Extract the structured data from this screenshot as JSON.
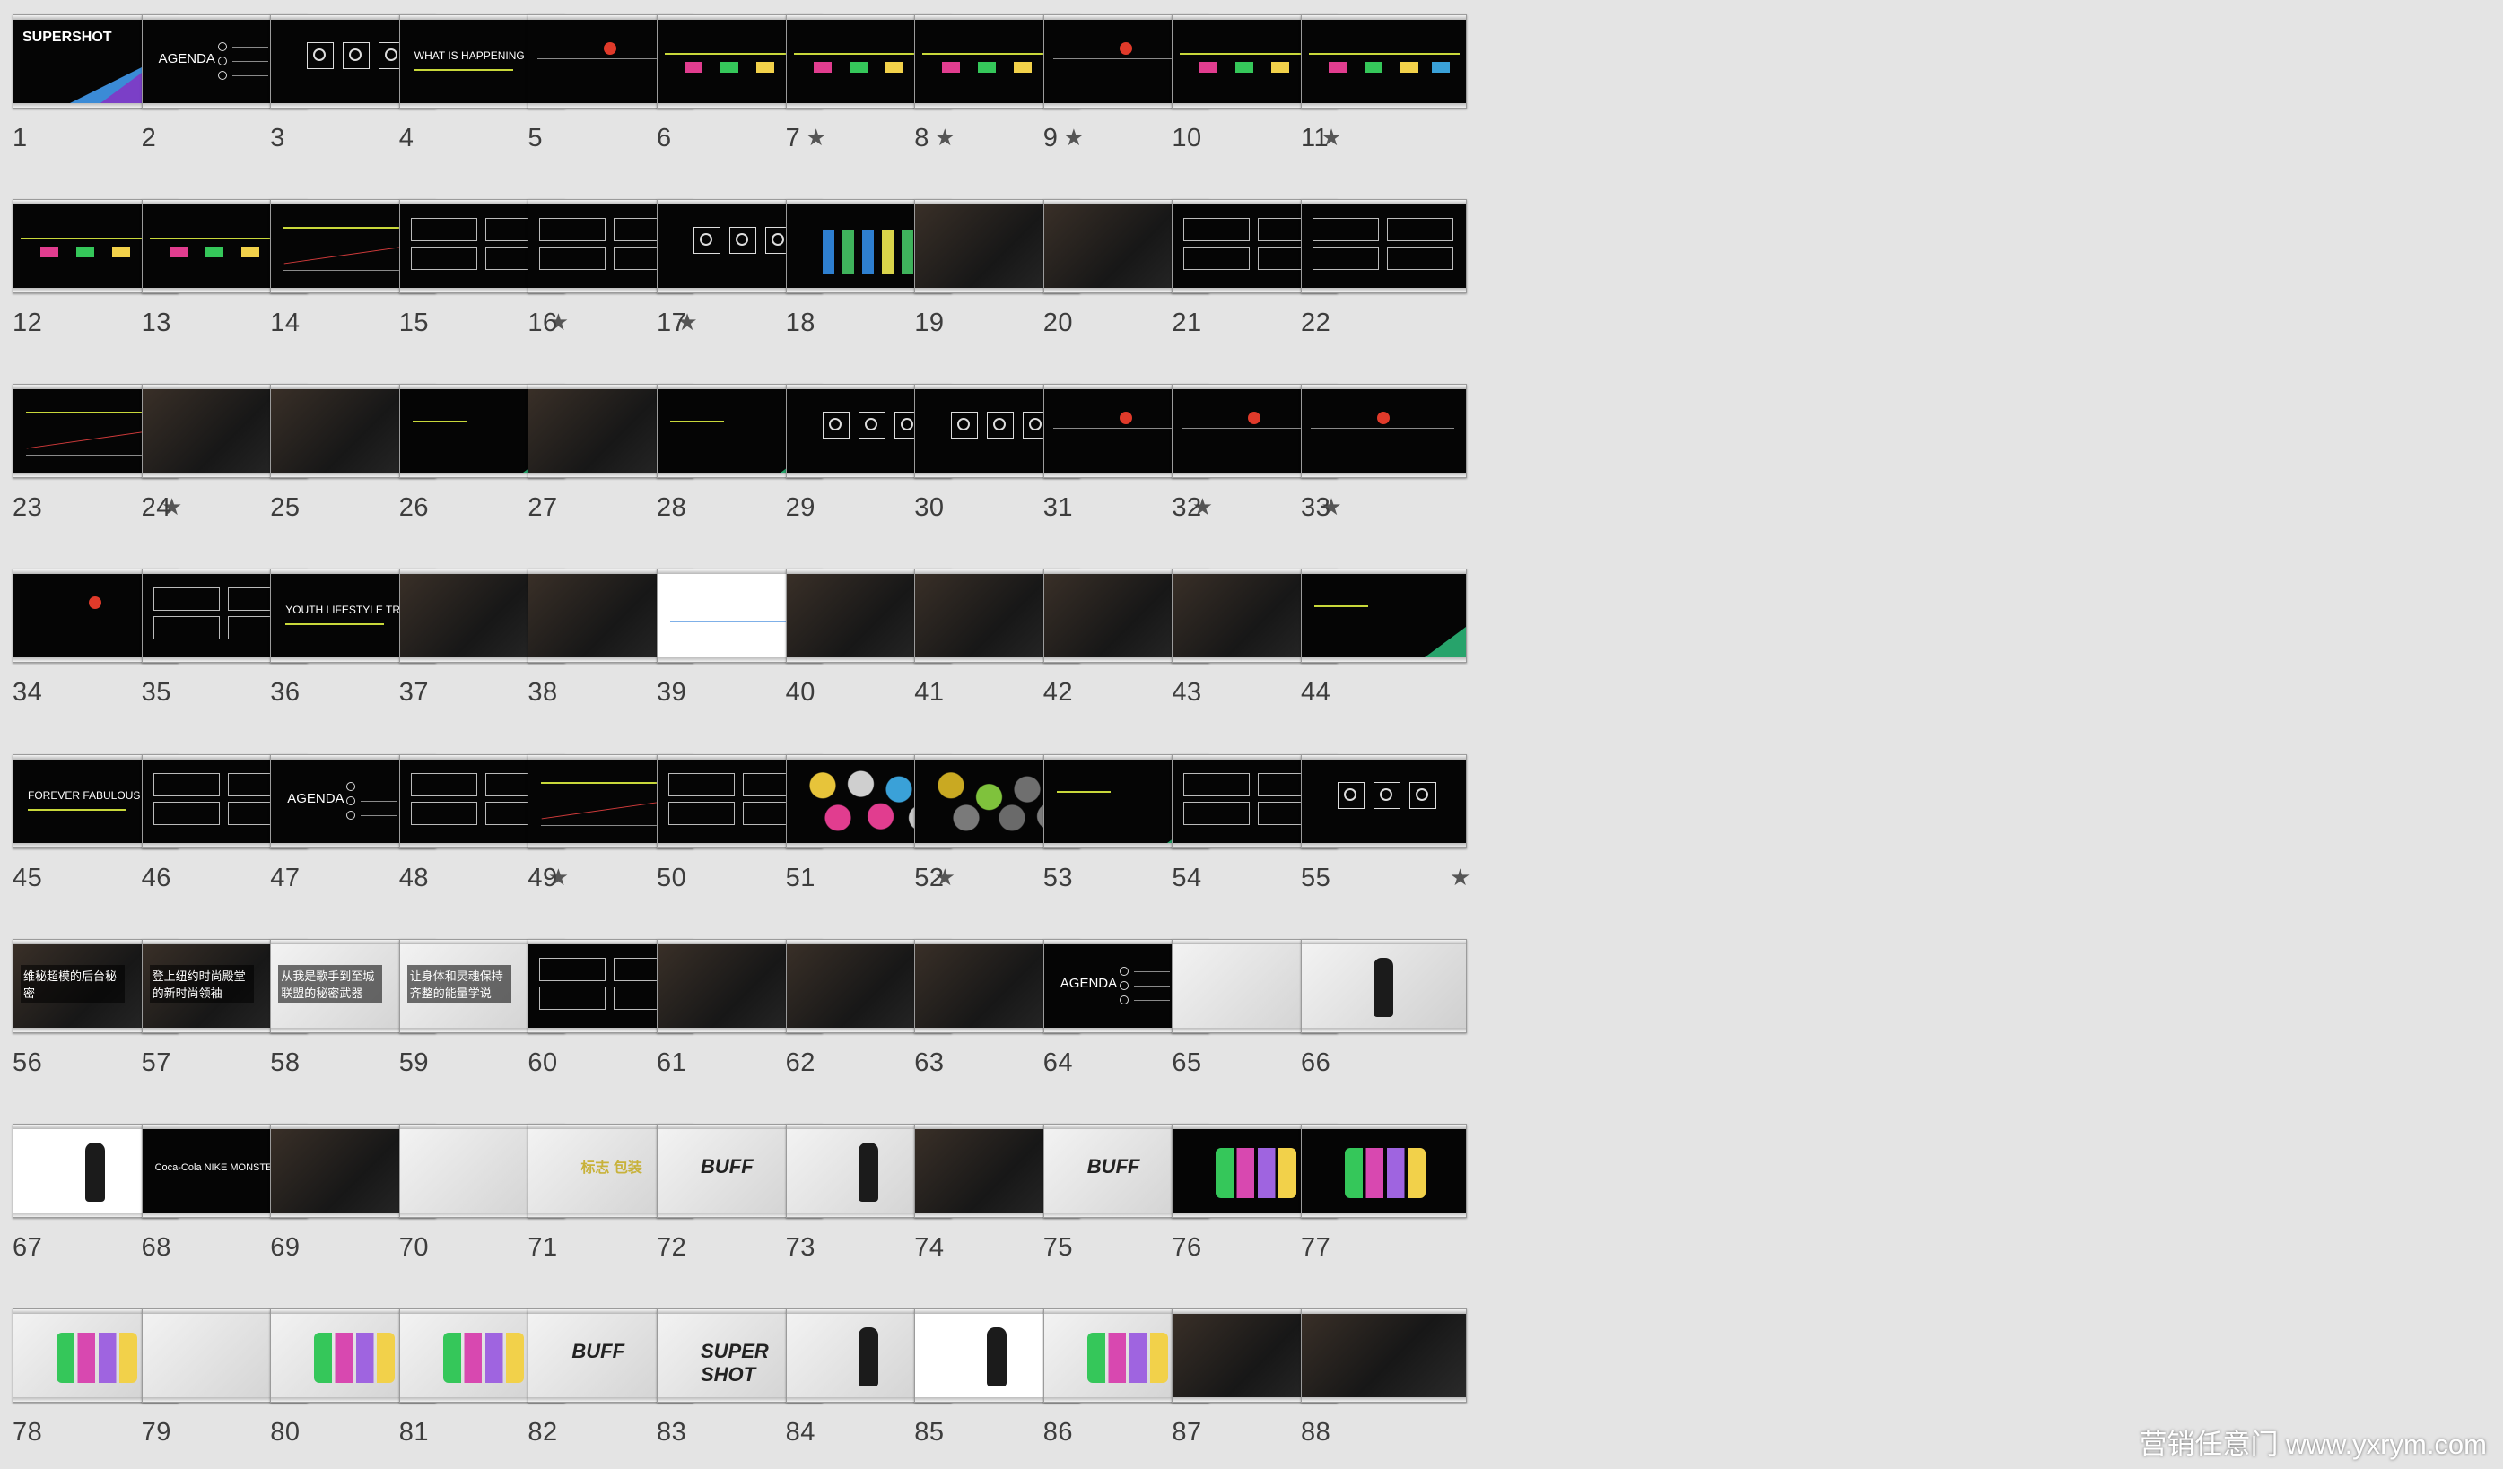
{
  "app": {
    "view": "slide-sorter"
  },
  "slides": [
    {
      "n": "1",
      "star": false,
      "style": "cover",
      "title": "SUPERSHOT"
    },
    {
      "n": "2",
      "star": false,
      "style": "agenda",
      "title": "AGENDA"
    },
    {
      "n": "3",
      "star": false,
      "style": "icons"
    },
    {
      "n": "4",
      "star": false,
      "style": "title",
      "title": "WHAT IS HAPPENING"
    },
    {
      "n": "5",
      "star": false,
      "style": "line"
    },
    {
      "n": "6",
      "star": true,
      "style": "timeline"
    },
    {
      "n": "7",
      "star": true,
      "style": "timeline"
    },
    {
      "n": "8",
      "star": true,
      "style": "timeline"
    },
    {
      "n": "9",
      "star": false,
      "style": "line"
    },
    {
      "n": "10",
      "star": true,
      "style": "timeline"
    },
    {
      "n": "11",
      "star": false,
      "style": "timeline"
    },
    {
      "n": "12",
      "star": false,
      "style": "timeline"
    },
    {
      "n": "13",
      "star": false,
      "style": "timeline"
    },
    {
      "n": "14",
      "star": false,
      "style": "chart-line"
    },
    {
      "n": "15",
      "star": true,
      "style": "boxes"
    },
    {
      "n": "16",
      "star": true,
      "style": "boxes"
    },
    {
      "n": "17",
      "star": false,
      "style": "icons"
    },
    {
      "n": "18",
      "star": false,
      "style": "bars"
    },
    {
      "n": "19",
      "star": false,
      "style": "photo"
    },
    {
      "n": "20",
      "star": false,
      "style": "photo"
    },
    {
      "n": "21",
      "star": false,
      "style": "boxes"
    },
    {
      "n": "22",
      "star": false,
      "style": "boxes"
    },
    {
      "n": "23",
      "star": true,
      "style": "chart-line"
    },
    {
      "n": "24",
      "star": false,
      "style": "photo"
    },
    {
      "n": "25",
      "star": false,
      "style": "photo"
    },
    {
      "n": "26",
      "star": false,
      "style": "tri"
    },
    {
      "n": "27",
      "star": false,
      "style": "photo"
    },
    {
      "n": "28",
      "star": false,
      "style": "tri"
    },
    {
      "n": "29",
      "star": false,
      "style": "icons"
    },
    {
      "n": "30",
      "star": false,
      "style": "icons"
    },
    {
      "n": "31",
      "star": true,
      "style": "line"
    },
    {
      "n": "32",
      "star": true,
      "style": "line"
    },
    {
      "n": "33",
      "star": false,
      "style": "line"
    },
    {
      "n": "34",
      "star": false,
      "style": "line"
    },
    {
      "n": "35",
      "star": false,
      "style": "boxes"
    },
    {
      "n": "36",
      "star": false,
      "style": "title",
      "title": "YOUTH LIFESTYLE TREND"
    },
    {
      "n": "37",
      "star": false,
      "style": "photo"
    },
    {
      "n": "38",
      "star": false,
      "style": "photo"
    },
    {
      "n": "39",
      "star": false,
      "style": "white"
    },
    {
      "n": "40",
      "star": false,
      "style": "photo"
    },
    {
      "n": "41",
      "star": false,
      "style": "photo"
    },
    {
      "n": "42",
      "star": false,
      "style": "photo"
    },
    {
      "n": "43",
      "star": false,
      "style": "photo"
    },
    {
      "n": "44",
      "star": false,
      "style": "tri"
    },
    {
      "n": "45",
      "star": false,
      "style": "title",
      "title": "FOREVER FABULOUS"
    },
    {
      "n": "46",
      "star": false,
      "style": "boxes"
    },
    {
      "n": "47",
      "star": false,
      "style": "agenda",
      "title": "AGENDA"
    },
    {
      "n": "48",
      "star": true,
      "style": "boxes"
    },
    {
      "n": "49",
      "star": false,
      "style": "chart-line"
    },
    {
      "n": "50",
      "star": false,
      "style": "boxes"
    },
    {
      "n": "51",
      "star": true,
      "style": "hex"
    },
    {
      "n": "52",
      "star": false,
      "style": "hex-grey"
    },
    {
      "n": "53",
      "star": false,
      "style": "tri"
    },
    {
      "n": "54",
      "star": false,
      "style": "boxes"
    },
    {
      "n": "55",
      "star": true,
      "style": "icons"
    },
    {
      "n": "56",
      "star": false,
      "style": "photo-cn",
      "title": "维秘超模的后台秘密"
    },
    {
      "n": "57",
      "star": false,
      "style": "photo-cn",
      "title": "登上纽约时尚殿堂的新时尚领袖"
    },
    {
      "n": "58",
      "star": false,
      "style": "photo-cn-light",
      "title": "从我是歌手到至城联盟的秘密武器"
    },
    {
      "n": "59",
      "star": false,
      "style": "photo-cn-light",
      "title": "让身体和灵魂保持齐整的能量学说"
    },
    {
      "n": "60",
      "star": false,
      "style": "boxes"
    },
    {
      "n": "61",
      "star": false,
      "style": "photo"
    },
    {
      "n": "62",
      "star": false,
      "style": "photo"
    },
    {
      "n": "63",
      "star": false,
      "style": "photo"
    },
    {
      "n": "64",
      "star": false,
      "style": "agenda",
      "title": "AGENDA"
    },
    {
      "n": "65",
      "star": false,
      "style": "light"
    },
    {
      "n": "66",
      "star": false,
      "style": "bottle"
    },
    {
      "n": "67",
      "star": false,
      "style": "white-bottles"
    },
    {
      "n": "68",
      "star": false,
      "style": "logos",
      "title": "Coca-Cola NIKE MONSTER"
    },
    {
      "n": "69",
      "star": false,
      "style": "photo"
    },
    {
      "n": "70",
      "star": false,
      "style": "light"
    },
    {
      "n": "71",
      "star": false,
      "style": "light-cn",
      "title": "标志 包装"
    },
    {
      "n": "72",
      "star": false,
      "style": "light-logo",
      "title": "BUFF"
    },
    {
      "n": "73",
      "star": false,
      "style": "bottle"
    },
    {
      "n": "74",
      "star": false,
      "style": "photo"
    },
    {
      "n": "75",
      "star": false,
      "style": "light-logo",
      "title": "BUFF"
    },
    {
      "n": "76",
      "star": false,
      "style": "cans"
    },
    {
      "n": "77",
      "star": false,
      "style": "cans"
    },
    {
      "n": "78",
      "star": false,
      "style": "cans-light"
    },
    {
      "n": "79",
      "star": false,
      "style": "light"
    },
    {
      "n": "80",
      "star": false,
      "style": "cans-light"
    },
    {
      "n": "81",
      "star": false,
      "style": "cans-light"
    },
    {
      "n": "82",
      "star": false,
      "style": "light-logo",
      "title": "BUFF"
    },
    {
      "n": "83",
      "star": false,
      "style": "light-logo",
      "title": "SUPER SHOT"
    },
    {
      "n": "84",
      "star": false,
      "style": "bottle"
    },
    {
      "n": "85",
      "star": false,
      "style": "white-bottles"
    },
    {
      "n": "86",
      "star": false,
      "style": "cans-light"
    },
    {
      "n": "87",
      "star": false,
      "style": "photo"
    },
    {
      "n": "88",
      "star": false,
      "style": "photo"
    }
  ],
  "watermark": "营销任意门 www.yxrym.com",
  "colors": {
    "background": "#e4e4e4",
    "number": "#3d3d3d",
    "accent": "#c8d83a"
  },
  "icons": {
    "star": "star-icon"
  }
}
